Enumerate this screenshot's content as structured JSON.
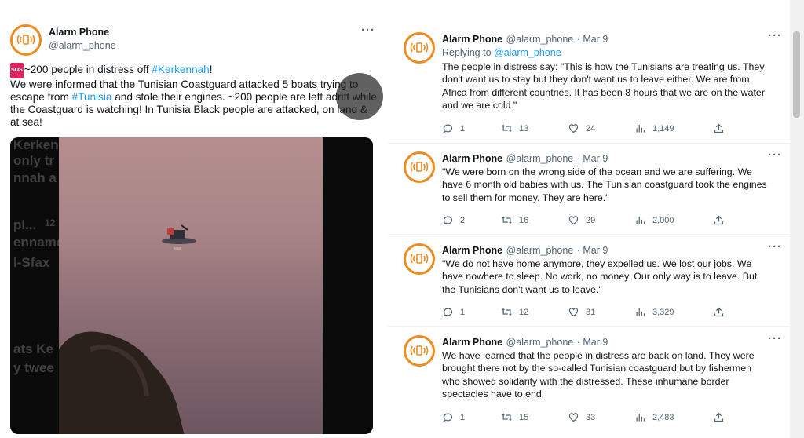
{
  "colors": {
    "accent": "#1d9bf0",
    "avatar_ring": "#f08a1c",
    "sos": "#e0245e"
  },
  "main_tweet": {
    "name": "Alarm Phone",
    "handle": "@alarm_phone",
    "more": "···",
    "sos_emoji": "SOS",
    "text_part1": "~200 people in distress off ",
    "hashtag1": "#Kerkennah",
    "text_part2": "!\nWe were informed that the Tunisian Coastguard attacked 5 boats trying to escape from ",
    "hashtag2": "#Tunisia",
    "text_part3": " and stole their engines. ~200 people are left adrift while the Coastguard is watching! In Tunisia Black people are attacked, on land & at sea!",
    "video_ghost_text": [
      "Kerkenn",
      "only tr",
      "nnah a",
      "pl...",
      "12",
      "enname",
      "l-Sfax",
      "ats Ke",
      "y twee"
    ]
  },
  "replies": [
    {
      "name": "Alarm Phone",
      "handle": "@alarm_phone",
      "date": "· Mar 9",
      "more": "···",
      "replying_prefix": "Replying to ",
      "replying_to": "@alarm_phone",
      "text": "The people in distress say: \"This is how the Tunisians are treating us. They don't want us to stay but they don't want us to leave either. We are from Africa from different countries. It has been 8 hours that we are on the water and we are cold.\"",
      "replies": "1",
      "retweets": "13",
      "likes": "24",
      "views": "1,149"
    },
    {
      "name": "Alarm Phone",
      "handle": "@alarm_phone",
      "date": "· Mar 9",
      "more": "···",
      "text": "\"We were born on the wrong side of the ocean and we are suffering. We have 6 month old babies with us. The Tunisian coastguard took the engines to sell them for money. They are here.\"",
      "replies": "2",
      "retweets": "16",
      "likes": "29",
      "views": "2,000"
    },
    {
      "name": "Alarm Phone",
      "handle": "@alarm_phone",
      "date": "· Mar 9",
      "more": "···",
      "text": "\"We do not have home anymore, they expelled us. We lost our jobs. We have nowhere to sleep. No work, no money. Our only way is to leave. But the Tunisians don't want us to leave.\"",
      "replies": "1",
      "retweets": "12",
      "likes": "31",
      "views": "3,329"
    },
    {
      "name": "Alarm Phone",
      "handle": "@alarm_phone",
      "date": "· Mar 9",
      "more": "···",
      "text": "We have learned that the people in distress are back on land. They were brought there not by the so-called Tunisian coastguard but by fishermen who showed solidarity with the distressed. These inhumane border spectacles have to end!",
      "replies": "1",
      "retweets": "15",
      "likes": "33",
      "views": "2,483"
    }
  ]
}
